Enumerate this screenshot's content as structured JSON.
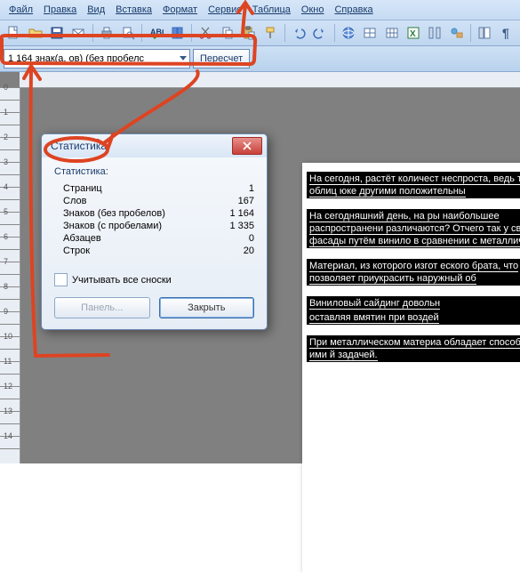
{
  "menu": {
    "file": "Файл",
    "edit": "Правка",
    "view": "Вид",
    "insert": "Вставка",
    "format": "Формат",
    "tools": "Сервис",
    "table": "Таблица",
    "window": "Окно",
    "help": "Справка"
  },
  "countbar": {
    "field": "1 164 знак(а, ов) (без пробелс",
    "recalc": "Пересчет"
  },
  "dialog": {
    "title": "Статистика",
    "heading": "Статистика:",
    "rows": [
      {
        "label": "Страниц",
        "value": "1"
      },
      {
        "label": "Слов",
        "value": "167"
      },
      {
        "label": "Знаков (без пробелов)",
        "value": "1 164"
      },
      {
        "label": "Знаков (с пробелами)",
        "value": "1 335"
      },
      {
        "label": "Абзацев",
        "value": "0"
      },
      {
        "label": "Строк",
        "value": "20"
      }
    ],
    "footnotes_cb": "Учитывать все сноски",
    "panel_btn": "Панель...",
    "close_btn": "Закрыть"
  },
  "doc": {
    "p1": "На сегодня, растёт количест неспроста, ведь такая облиц юке другими положительны",
    "p2": "На сегодняшний день, на ры наибольшее распространени  различаются? Отчего так у  свои фасады путём винило в сравнении с металличе",
    "p3": "Материал, из которого изгот еского брата, что позволяет приукрасить наружный об",
    "p4a": "Виниловый сайдинг довольн",
    "p4b": "оставляя вмятин при воздей",
    "p5": "При металлическом материа обладает способностью ими й задачей."
  }
}
